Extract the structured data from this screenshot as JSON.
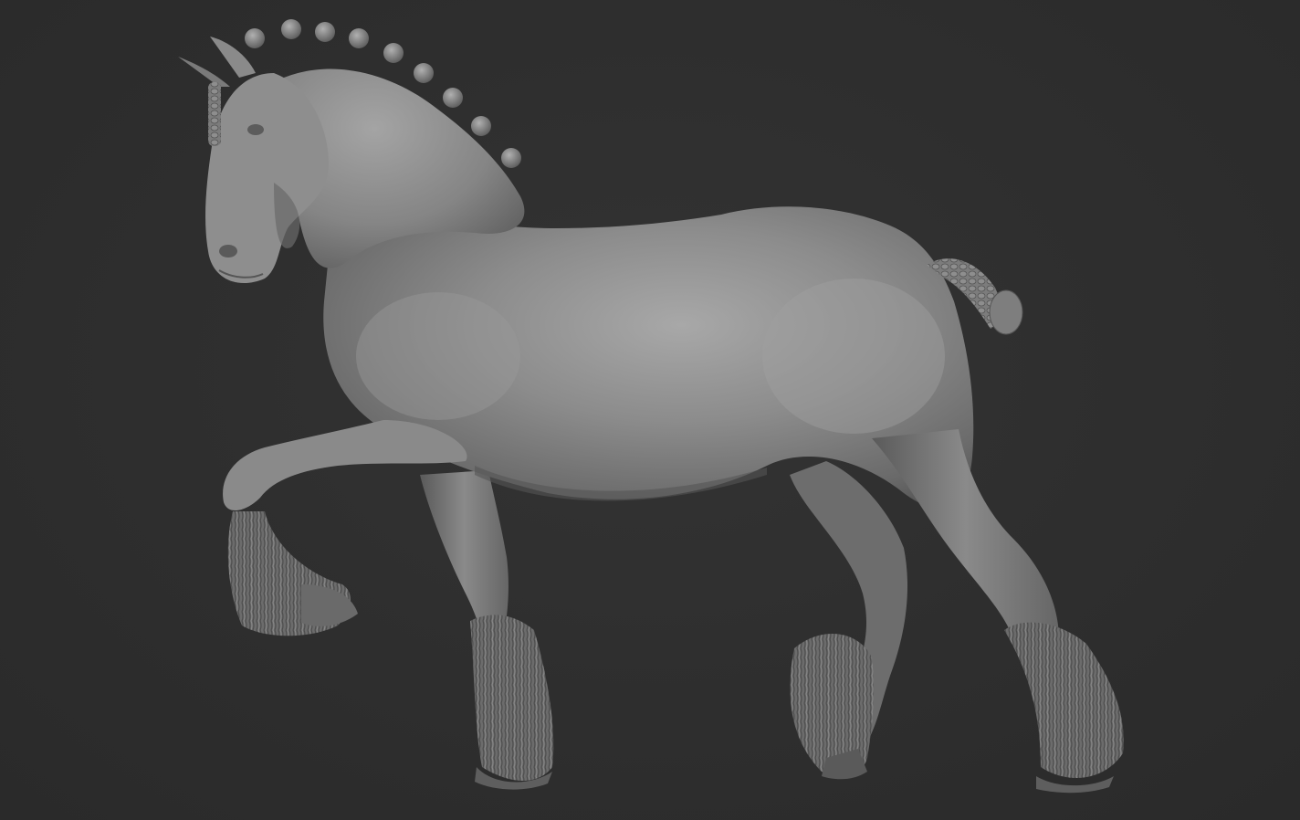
{
  "scene": {
    "subject": "horse-sculpt",
    "background_color": "#2d2d2d",
    "material_base_color": "#8a8a8a",
    "material_highlight_color": "#b4b4b4",
    "material_shadow_color": "#4a4a4a"
  }
}
